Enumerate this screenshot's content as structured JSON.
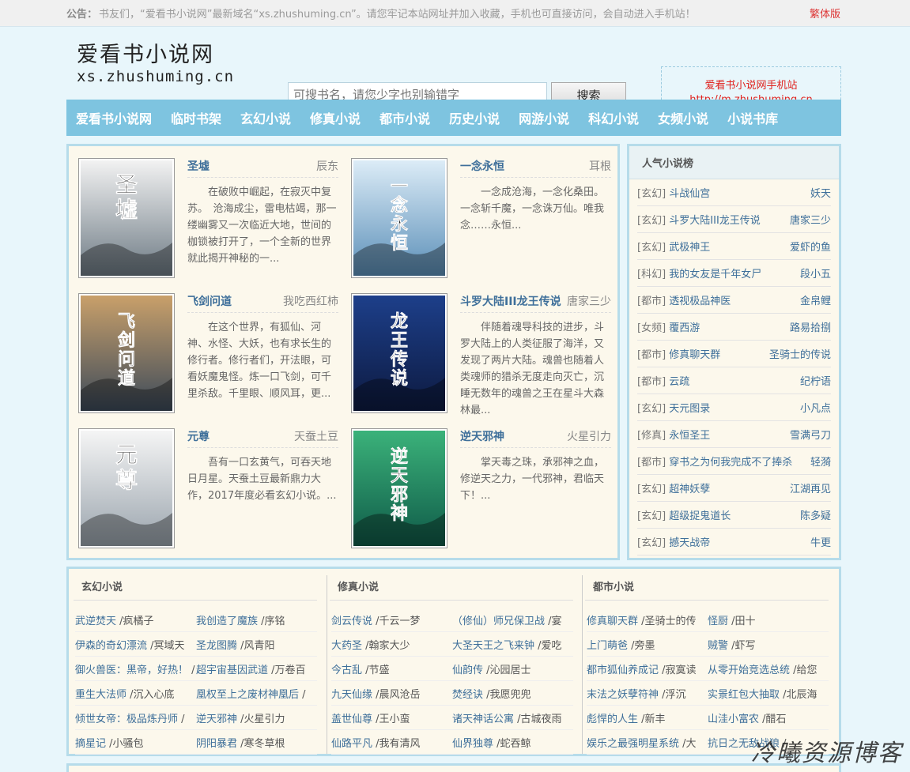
{
  "notice": {
    "label": "公告：",
    "text": "书友们，“爱看书小说网”最新域名“xs.zhushuming.cn”。请您牢记本站网址并加入收藏，手机也可直接访问，会自动进入手机站！",
    "traditional_link": "繁体版"
  },
  "logo": {
    "title": "爱看书小说网",
    "domain": "xs.zhushuming.cn"
  },
  "search": {
    "placeholder": "可搜书名，请您少字也别输错字",
    "button": "搜索"
  },
  "mobile": {
    "line1": "爱看书小说网手机站",
    "line2": "http://m.zhushuming.cn"
  },
  "nav": [
    "爱看书小说网",
    "临时书架",
    "玄幻小说",
    "修真小说",
    "都市小说",
    "历史小说",
    "网游小说",
    "科幻小说",
    "女频小说",
    "小说书库"
  ],
  "featured": [
    {
      "title": "圣墟",
      "author": "辰东",
      "desc": "在破败中崛起，在寂灭中复苏。　沧海成尘，雷电枯竭，那一缕幽雾又一次临近大地，世间的枷锁被打开了，一个全新的世界就此揭开神秘的一...",
      "cover_text": "圣墟",
      "colors": [
        "#f2f2f2",
        "#6e7b85"
      ]
    },
    {
      "title": "一念永恒",
      "author": "耳根",
      "desc": "一念成沧海，一念化桑田。一念斩千魔，一念诛万仙。唯我念……永恒...",
      "cover_text": "一念永恒",
      "colors": [
        "#dcecf7",
        "#5b8fb8"
      ]
    },
    {
      "title": "飞剑问道",
      "author": "我吃西红柿",
      "desc": "在这个世界，有狐仙、河神、水怪、大妖，也有求长生的修行者。修行者们，开法眼，可看妖魔鬼怪。炼一口飞剑，可千里杀敌。千里眼、顺风耳，更...",
      "cover_text": "飞剑问道",
      "colors": [
        "#c9a06a",
        "#3c4a5a"
      ]
    },
    {
      "title": "斗罗大陆III龙王传说",
      "author": "唐家三少",
      "desc": "伴随着魂导科技的进步，斗罗大陆上的人类征服了海洋，又发现了两片大陆。魂兽也随着人类魂师的猎杀无度走向灭亡，沉睡无数年的魂兽之王在星斗大森林最...",
      "cover_text": "龙王传说",
      "colors": [
        "#1d3f8a",
        "#0d1a40"
      ]
    },
    {
      "title": "元尊",
      "author": "天蚕土豆",
      "desc": "吾有一口玄黄气，可吞天地日月星。天蚕土豆最新鼎力大作，2017年度必看玄幻小说。...",
      "cover_text": "元尊",
      "colors": [
        "#f5f5f5",
        "#9aa4ad"
      ]
    },
    {
      "title": "逆天邪神",
      "author": "火星引力",
      "desc": "掌天毒之珠，承邪神之血，修逆天之力，一代邪神，君临天下！...",
      "cover_text": "逆天邪神",
      "colors": [
        "#3bb27a",
        "#0f5a48"
      ]
    }
  ],
  "ranking": {
    "title": "人气小说榜",
    "items": [
      {
        "cat": "[玄幻]",
        "title": "斗战仙宫",
        "author": "妖天"
      },
      {
        "cat": "[玄幻]",
        "title": "斗罗大陆III龙王传说",
        "author": "唐家三少"
      },
      {
        "cat": "[玄幻]",
        "title": "武极神王",
        "author": "爱虾的鱼"
      },
      {
        "cat": "[科幻]",
        "title": "我的女友是千年女尸",
        "author": "段小五"
      },
      {
        "cat": "[都市]",
        "title": "透视极品神医",
        "author": "金帛鲤"
      },
      {
        "cat": "[女频]",
        "title": "覆西游",
        "author": "路易拾捌"
      },
      {
        "cat": "[都市]",
        "title": "修真聊天群",
        "author": "圣骑士的传说"
      },
      {
        "cat": "[都市]",
        "title": "云疏",
        "author": "纪柠语"
      },
      {
        "cat": "[玄幻]",
        "title": "天元图录",
        "author": "小凡点"
      },
      {
        "cat": "[修真]",
        "title": "永恒圣王",
        "author": "雪满弓刀"
      },
      {
        "cat": "[都市]",
        "title": "穿书之为何我完成不了捧杀",
        "author": "轻漪"
      },
      {
        "cat": "[玄幻]",
        "title": "超神妖孽",
        "author": "江湖再见"
      },
      {
        "cat": "[玄幻]",
        "title": "超级捉鬼道长",
        "author": "陈多疑"
      },
      {
        "cat": "[玄幻]",
        "title": "撼天战帝",
        "author": "牛更"
      }
    ]
  },
  "categories": [
    {
      "title": "玄幻小说",
      "items": [
        [
          "武逆焚天",
          "疯橘子"
        ],
        [
          "我创造了魔族",
          "序铭"
        ],
        [
          "伊森的奇幻漂流",
          "冥域天"
        ],
        [
          "圣龙图腾",
          "风青阳"
        ],
        [
          "御火兽医：黑帝，好热！",
          ""
        ],
        [
          "超宇宙基因武道",
          "万卷百"
        ],
        [
          "重生大法师",
          "沉入心底"
        ],
        [
          "凰权至上之废材神凰后",
          ""
        ],
        [
          "倾世女帝：极品炼丹师",
          ""
        ],
        [
          "逆天邪神",
          "火星引力"
        ],
        [
          "摘星记",
          "小骚包"
        ],
        [
          "阴阳暴君",
          "寒冬草根"
        ]
      ]
    },
    {
      "title": "修真小说",
      "items": [
        [
          "剑云传说",
          "千云一梦"
        ],
        [
          "（修仙）师兄保卫战",
          "宴"
        ],
        [
          "大药圣",
          "翰家大少"
        ],
        [
          "大圣天王之飞来钟",
          "爱吃"
        ],
        [
          "今古乱",
          "节盛"
        ],
        [
          "仙韵传",
          "沁园居士"
        ],
        [
          "九天仙缘",
          "晨风沧岳"
        ],
        [
          "焚经诀",
          "我愿兜兜"
        ],
        [
          "盖世仙尊",
          "王小蛮"
        ],
        [
          "诸天神话公寓",
          "古城夜雨"
        ],
        [
          "仙路平凡",
          "我有清风"
        ],
        [
          "仙界独尊",
          "蛇吞鲸"
        ]
      ]
    },
    {
      "title": "都市小说",
      "items": [
        [
          "修真聊天群",
          "圣骑士的传"
        ],
        [
          "怪厨",
          "田十"
        ],
        [
          "上门萌爸",
          "旁墨"
        ],
        [
          "贼警",
          "虾写"
        ],
        [
          "都市狐仙养成记",
          "寂寞读"
        ],
        [
          "从零开始竞选总统",
          "给您"
        ],
        [
          "末法之妖孽符神",
          "浮沉"
        ],
        [
          "实景红包大抽取",
          "北辰海"
        ],
        [
          "彪悍的人生",
          "新丰"
        ],
        [
          "山洼小富农",
          "醋石"
        ],
        [
          "娱乐之最强明星系统",
          "大"
        ],
        [
          "抗日之无敌战狼",
          ""
        ]
      ]
    }
  ],
  "watermark": "冷曦资源博客"
}
